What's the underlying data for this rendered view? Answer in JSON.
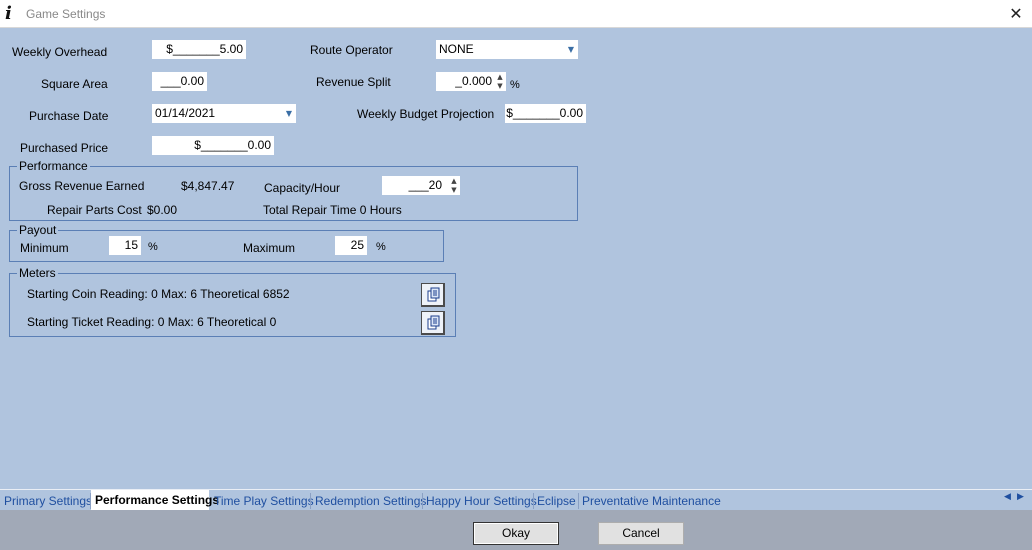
{
  "window": {
    "title": "Game Settings",
    "app_icon": "info-i-icon",
    "close_icon": "close-x-icon"
  },
  "form": {
    "weekly_overhead": {
      "label": "Weekly Overhead",
      "value": "$_______5.00"
    },
    "square_area": {
      "label": "Square Area",
      "value": "___0.00"
    },
    "purchase_date": {
      "label": "Purchase Date",
      "value": "01/14/2021"
    },
    "purchased_price": {
      "label": "Purchased Price",
      "value": "$_______0.00"
    },
    "route_operator": {
      "label": "Route Operator",
      "value": "NONE"
    },
    "revenue_split": {
      "label": "Revenue Split",
      "value": "_0.000",
      "unit": "%"
    },
    "weekly_budget": {
      "label": "Weekly Budget Projection",
      "value": "$_______0.00"
    }
  },
  "performance": {
    "title": "Performance",
    "gross_revenue_label": "Gross Revenue Earned",
    "gross_revenue_value": "$4,847.47",
    "capacity_label": "Capacity/Hour",
    "capacity_value": "___20",
    "repair_parts_label": "Repair Parts Cost",
    "repair_parts_value": "$0.00",
    "repair_time_text": "Total Repair Time 0 Hours"
  },
  "payout": {
    "title": "Payout",
    "min_label": "Minimum",
    "min_value": "15",
    "max_label": "Maximum",
    "max_value": "25",
    "unit": "%"
  },
  "meters": {
    "title": "Meters",
    "coin_text": "Starting Coin Reading: 0 Max: 6  Theoretical 6852",
    "ticket_text": "Starting Ticket Reading: 0  Max: 6  Theoretical 0",
    "button_icon": "clipboard-icon"
  },
  "tabs": [
    {
      "label": "Primary Settings"
    },
    {
      "label": "Performance Settings",
      "active": true
    },
    {
      "label": "Time Play Settings"
    },
    {
      "label": "Redemption Settings"
    },
    {
      "label": "Happy Hour Settings"
    },
    {
      "label": "Eclipse"
    },
    {
      "label": "Preventative Maintenance"
    }
  ],
  "buttons": {
    "okay": "Okay",
    "cancel": "Cancel"
  },
  "colors": {
    "background": "#B0C4DE",
    "footer": "#A1A9B7",
    "tab_text": "#1f4fa0",
    "group_border": "#5b7fb5"
  }
}
